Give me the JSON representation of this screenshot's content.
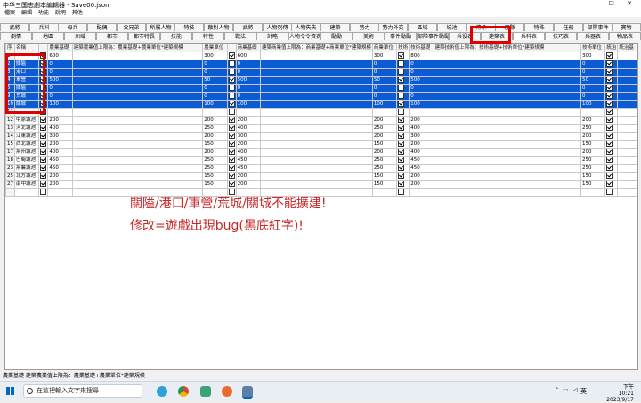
{
  "window": {
    "title": "中华三国志劇本編輯器 - Save00.json",
    "controls": "— ☐ ✕"
  },
  "menu": [
    "檔案",
    "編輯",
    "功能",
    "說明",
    "其他"
  ],
  "tabs_row1": [
    "武將",
    "兵科",
    "母兵",
    "配偶",
    "父兄弟",
    "所屬人物",
    "特技",
    "敵對人物",
    "武將",
    "人物列傳",
    "人物失失",
    "建築",
    "勢力",
    "勢力外交",
    "區域",
    "城池",
    "傳承",
    "郡縣",
    "特殊",
    "任務",
    "部隊事件",
    "寶物"
  ],
  "tabs_row2": [
    "劇情",
    "地區",
    "州域",
    "都市",
    "都市特長",
    "技能",
    "特性",
    "戰法",
    "計略",
    "人物令令資表",
    "勵勵",
    "美術",
    "事件勵勵",
    "部隊事件勵勵",
    "兵役表",
    "建築表",
    "兵科表",
    "技巧表",
    "兵器表",
    "物品表"
  ],
  "grid": {
    "headers": [
      "序",
      "名稱",
      "",
      "農業基礎",
      "建築農業值上限為：農業基礎+農業單位*建築規模",
      "農業單位",
      "",
      "商業基礎",
      "建築商業值上限為：商業基礎+商業單位*建築規模",
      "商業單位",
      "技術",
      "技術基礎",
      "建築技術值上限為：技術基礎+技術單位*建築規模",
      "技術單位",
      "統治",
      "統治基"
    ],
    "rows": [
      {
        "n": "1",
        "name": "",
        "chk": true,
        "agr": "600",
        "ab": false,
        "agu": "300",
        "cb": true,
        "com": "600",
        "comu": "300",
        "tb": true,
        "tec": "800",
        "tecu": "300",
        "gb": true,
        "sel": false
      },
      {
        "n": "2",
        "name": "關隘",
        "chk": true,
        "agr": "0",
        "ab": false,
        "agu": "0",
        "cb": false,
        "com": "0",
        "comu": "0",
        "tb": false,
        "tec": "0",
        "tecu": "0",
        "gb": true,
        "sel": true
      },
      {
        "n": "3",
        "name": "港口",
        "chk": true,
        "agr": "0",
        "ab": false,
        "agu": "0",
        "cb": false,
        "com": "0",
        "comu": "0",
        "tb": false,
        "tec": "0",
        "tecu": "0",
        "gb": true,
        "sel": true
      },
      {
        "n": "4",
        "name": "軍營",
        "chk": true,
        "agr": "500",
        "ab": false,
        "agu": "50",
        "cb": true,
        "com": "500",
        "comu": "50",
        "tb": true,
        "tec": "500",
        "tecu": "50",
        "gb": true,
        "sel": true
      },
      {
        "n": "5",
        "name": "關隘",
        "chk": false,
        "agr": "0",
        "ab": false,
        "agu": "0",
        "cb": false,
        "com": "0",
        "comu": "0",
        "tb": false,
        "tec": "0",
        "tecu": "0",
        "gb": true,
        "sel": true
      },
      {
        "n": "9",
        "name": "荒城",
        "chk": true,
        "agr": "0",
        "ab": false,
        "agu": "0",
        "cb": false,
        "com": "0",
        "comu": "0",
        "tb": false,
        "tec": "0",
        "tecu": "0",
        "gb": true,
        "sel": true
      },
      {
        "n": "10",
        "name": "關城",
        "chk": true,
        "agr": "100",
        "ab": false,
        "agu": "100",
        "cb": true,
        "com": "100",
        "comu": "100",
        "tb": true,
        "tec": "100",
        "tecu": "100",
        "gb": true,
        "sel": true
      },
      {
        "n": "11",
        "name": "",
        "chk": true,
        "agr": "",
        "ab": false,
        "agu": "",
        "cb": false,
        "com": "",
        "comu": "",
        "tb": false,
        "tec": "",
        "tecu": "",
        "gb": true,
        "sel": false
      },
      {
        "n": "12",
        "name": "中原城池",
        "chk": true,
        "agr": "200",
        "ab": false,
        "agu": "200",
        "cb": true,
        "com": "200",
        "comu": "200",
        "tb": true,
        "tec": "200",
        "tecu": "200",
        "gb": true,
        "sel": false
      },
      {
        "n": "13",
        "name": "河北城池",
        "chk": true,
        "agr": "400",
        "ab": false,
        "agu": "250",
        "cb": true,
        "com": "400",
        "comu": "250",
        "tb": true,
        "tec": "400",
        "tecu": "250",
        "gb": true,
        "sel": false
      },
      {
        "n": "14",
        "name": "江東城池",
        "chk": true,
        "agr": "300",
        "ab": false,
        "agu": "200",
        "cb": true,
        "com": "300",
        "comu": "200",
        "tb": true,
        "tec": "300",
        "tecu": "200",
        "gb": true,
        "sel": false
      },
      {
        "n": "15",
        "name": "西北城池",
        "chk": true,
        "agr": "200",
        "ab": false,
        "agu": "150",
        "cb": true,
        "com": "200",
        "comu": "150",
        "tb": true,
        "tec": "200",
        "tecu": "150",
        "gb": true,
        "sel": false
      },
      {
        "n": "17",
        "name": "荊州城池",
        "chk": true,
        "agr": "400",
        "ab": false,
        "agu": "200",
        "cb": true,
        "com": "400",
        "comu": "200",
        "tb": true,
        "tec": "400",
        "tecu": "200",
        "gb": true,
        "sel": false
      },
      {
        "n": "18",
        "name": "巴蜀城池",
        "chk": true,
        "agr": "450",
        "ab": false,
        "agu": "250",
        "cb": true,
        "com": "450",
        "comu": "250",
        "tb": true,
        "tec": "450",
        "tecu": "250",
        "gb": true,
        "sel": false
      },
      {
        "n": "23",
        "name": "荊襄城池",
        "chk": true,
        "agr": "450",
        "ab": false,
        "agu": "250",
        "cb": true,
        "com": "450",
        "comu": "250",
        "tb": true,
        "tec": "450",
        "tecu": "250",
        "gb": true,
        "sel": false
      },
      {
        "n": "25",
        "name": "北方城池",
        "chk": true,
        "agr": "200",
        "ab": false,
        "agu": "150",
        "cb": true,
        "com": "200",
        "comu": "150",
        "tb": true,
        "tec": "200",
        "tecu": "150",
        "gb": true,
        "sel": false
      },
      {
        "n": "27",
        "name": "南中城池",
        "chk": true,
        "agr": "200",
        "ab": false,
        "agu": "150",
        "cb": true,
        "com": "200",
        "comu": "150",
        "tb": true,
        "tec": "200",
        "tecu": "150",
        "gb": true,
        "sel": false
      }
    ]
  },
  "notes": {
    "line1": "關隘/港口/軍營/荒城/關城不能擴建!",
    "line2": "修改=遊戲出現bug(黑底紅字)!"
  },
  "status_text": "農業基礎 建築農業值上限為：農業基礎+農業單位*建築規模",
  "taskbar": {
    "search_placeholder": "在這裡輸入文字來搜尋",
    "lang": "英",
    "time": "下午 10:21",
    "date": "2023/9/17"
  },
  "colors": {
    "selected_row": "#0a5bd4",
    "annotation": "#e00000",
    "note_text": "#c62828"
  }
}
